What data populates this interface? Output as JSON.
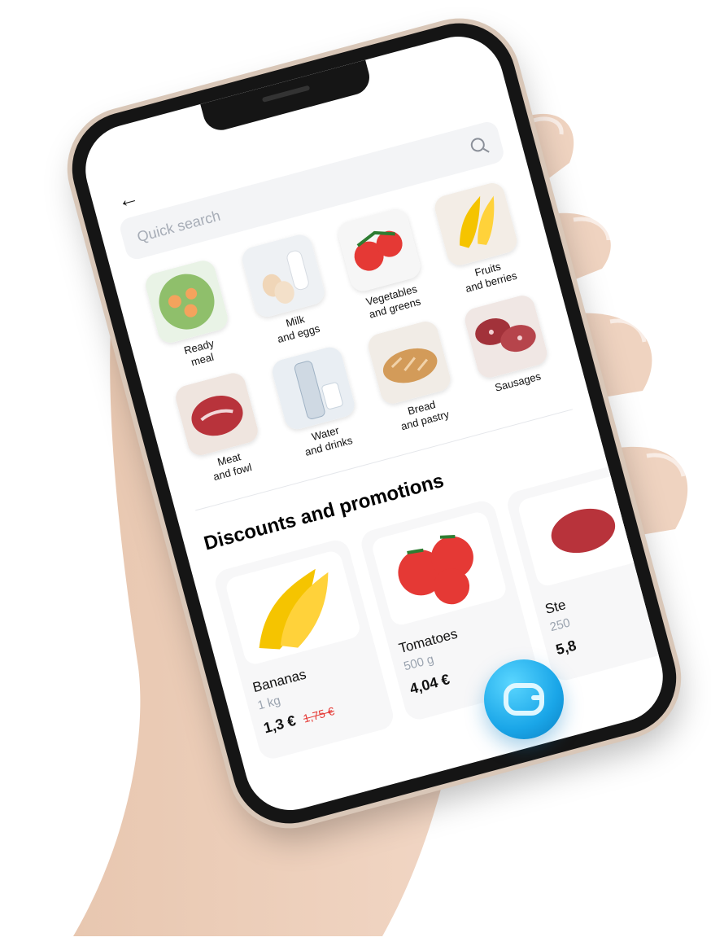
{
  "app": {
    "search": {
      "placeholder": "Quick search"
    },
    "categories": [
      {
        "label": "Ready\nmeal",
        "icon": "ready-meal-image"
      },
      {
        "label": "Milk\nand eggs",
        "icon": "milk-eggs-image"
      },
      {
        "label": "Vegetables\nand greens",
        "icon": "vegetables-image"
      },
      {
        "label": "Fruits\nand berries",
        "icon": "fruits-image"
      },
      {
        "label": "Meat\nand fowl",
        "icon": "meat-image"
      },
      {
        "label": "Water\nand drinks",
        "icon": "water-image"
      },
      {
        "label": "Bread\nand pastry",
        "icon": "bread-image"
      },
      {
        "label": "Sausages",
        "icon": "sausages-image"
      }
    ],
    "section_title": "Discounts and promotions",
    "promos": [
      {
        "name": "Bananas",
        "weight": "1 kg",
        "price": "1,3 €",
        "old_price": "1,75 €",
        "icon": "bananas-image"
      },
      {
        "name": "Tomatoes",
        "weight": "500 g",
        "price": "4,04 €",
        "old_price": "",
        "icon": "tomatoes-image"
      },
      {
        "name": "Ste",
        "weight": "250",
        "price": "5,8",
        "old_price": "",
        "icon": "steak-image"
      }
    ]
  },
  "colors": {
    "accent": "#1aa6e8",
    "discount_red": "#e53935",
    "muted_text": "#9aa3af",
    "card_bg": "#f7f7f8"
  }
}
